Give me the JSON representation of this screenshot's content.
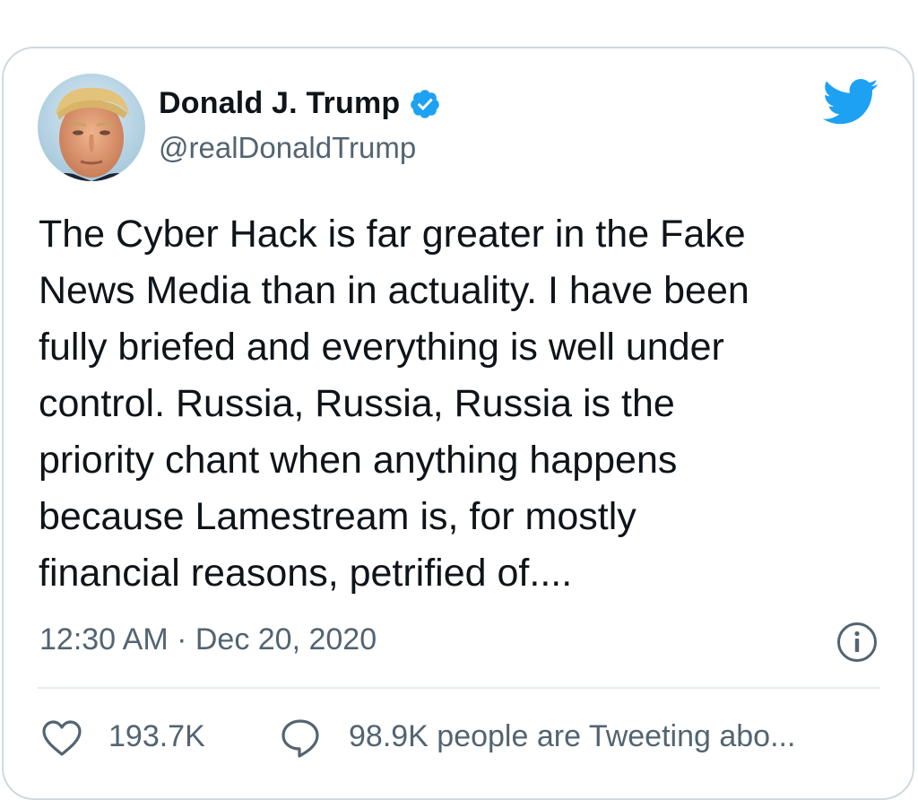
{
  "tweet": {
    "author": {
      "display_name": "Donald J. Trump",
      "handle": "@realDonaldTrump",
      "verified": true
    },
    "text_lines": [
      "The Cyber Hack is far greater in the Fake",
      "News Media than in actuality. I have been",
      "fully briefed and everything is well under",
      "control. Russia, Russia, Russia is the",
      "priority chant when anything happens",
      "because Lamestream is, for mostly",
      "financial reasons, petrified of...."
    ],
    "timestamp": "12:30 AM · Dec 20, 2020",
    "likes": "193.7K",
    "tweeting_text": "98.9K people are Tweeting abo..."
  },
  "icons": {
    "platform": "twitter-bird-icon",
    "verified": "verified-badge-icon",
    "info": "info-icon",
    "like": "heart-icon",
    "reply": "speech-bubble-icon"
  },
  "colors": {
    "brand": "#1DA1F2",
    "text": "#0F1419",
    "secondary_text": "#536471",
    "border": "#CFD9DE"
  }
}
